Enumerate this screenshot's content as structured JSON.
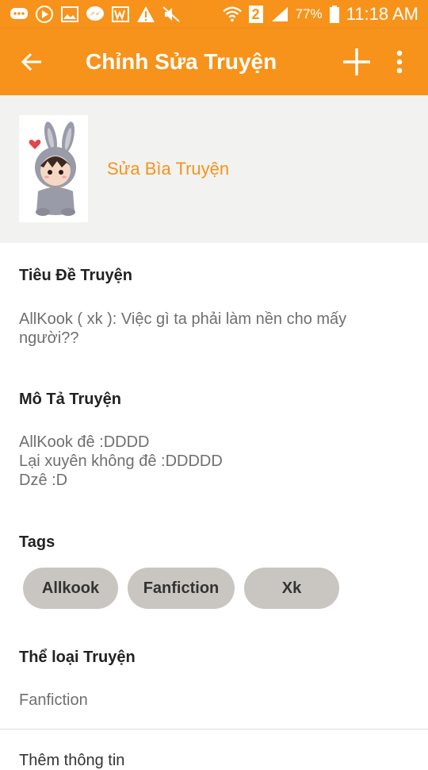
{
  "status_bar": {
    "battery_percent": "77%",
    "time": "11:18 AM",
    "sim_badge": "2",
    "icons": [
      "chat-icon",
      "play-icon",
      "gallery-icon",
      "messenger-icon",
      "wattpad-icon",
      "warning-icon",
      "mute-icon",
      "wifi-icon",
      "sim-icon",
      "signal-icon",
      "battery-icon"
    ]
  },
  "app_bar": {
    "title": "Chỉnh Sửa Truyện",
    "color": "#f7931a"
  },
  "cover": {
    "edit_link": "Sửa Bìa Truyện"
  },
  "sections": {
    "title_label": "Tiêu Đề Truyện",
    "title_value": "AllKook ( xk ): Việc gì ta phải làm nền cho mấy người??",
    "description_label": "Mô Tả Truyện",
    "description_lines": [
      "AllKook đê :DDDD",
      "Lại xuyên không đê :DDDDD",
      "Dzê :D"
    ],
    "tags_label": "Tags",
    "tags": [
      "Allkook",
      "Fanfiction",
      "Xk"
    ],
    "genre_label": "Thể loại Truyện",
    "genre_value": "Fanfiction",
    "more_info_label": "Thêm thông tin"
  }
}
